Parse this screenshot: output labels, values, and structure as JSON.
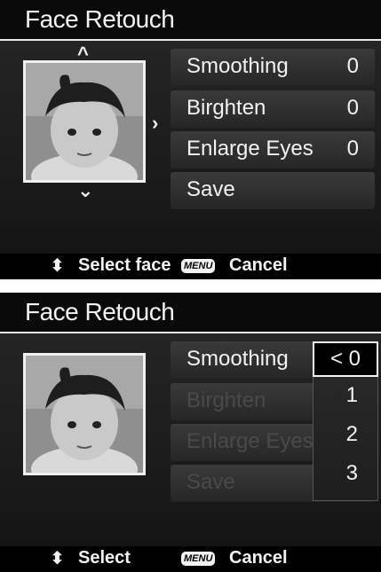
{
  "screen1": {
    "title": "Face Retouch",
    "nav_up": "^",
    "nav_down": "⌄",
    "nav_right": "›",
    "menu": [
      {
        "label": "Smoothing",
        "value": "0"
      },
      {
        "label": "Birghten",
        "value": "0"
      },
      {
        "label": "Enlarge Eyes",
        "value": "0"
      },
      {
        "label": "Save",
        "value": ""
      }
    ],
    "footer": {
      "select_label": "Select face",
      "menu_key": "MENU",
      "cancel_label": "Cancel"
    }
  },
  "screen2": {
    "title": "Face Retouch",
    "menu": [
      {
        "label": "Smoothing"
      },
      {
        "label": "Birghten"
      },
      {
        "label": "Enlarge Eyes"
      },
      {
        "label": "Save"
      }
    ],
    "options": [
      "< 0",
      "1",
      "2",
      "3"
    ],
    "footer": {
      "select_label": "Select",
      "menu_key": "MENU",
      "cancel_label": "Cancel"
    }
  }
}
